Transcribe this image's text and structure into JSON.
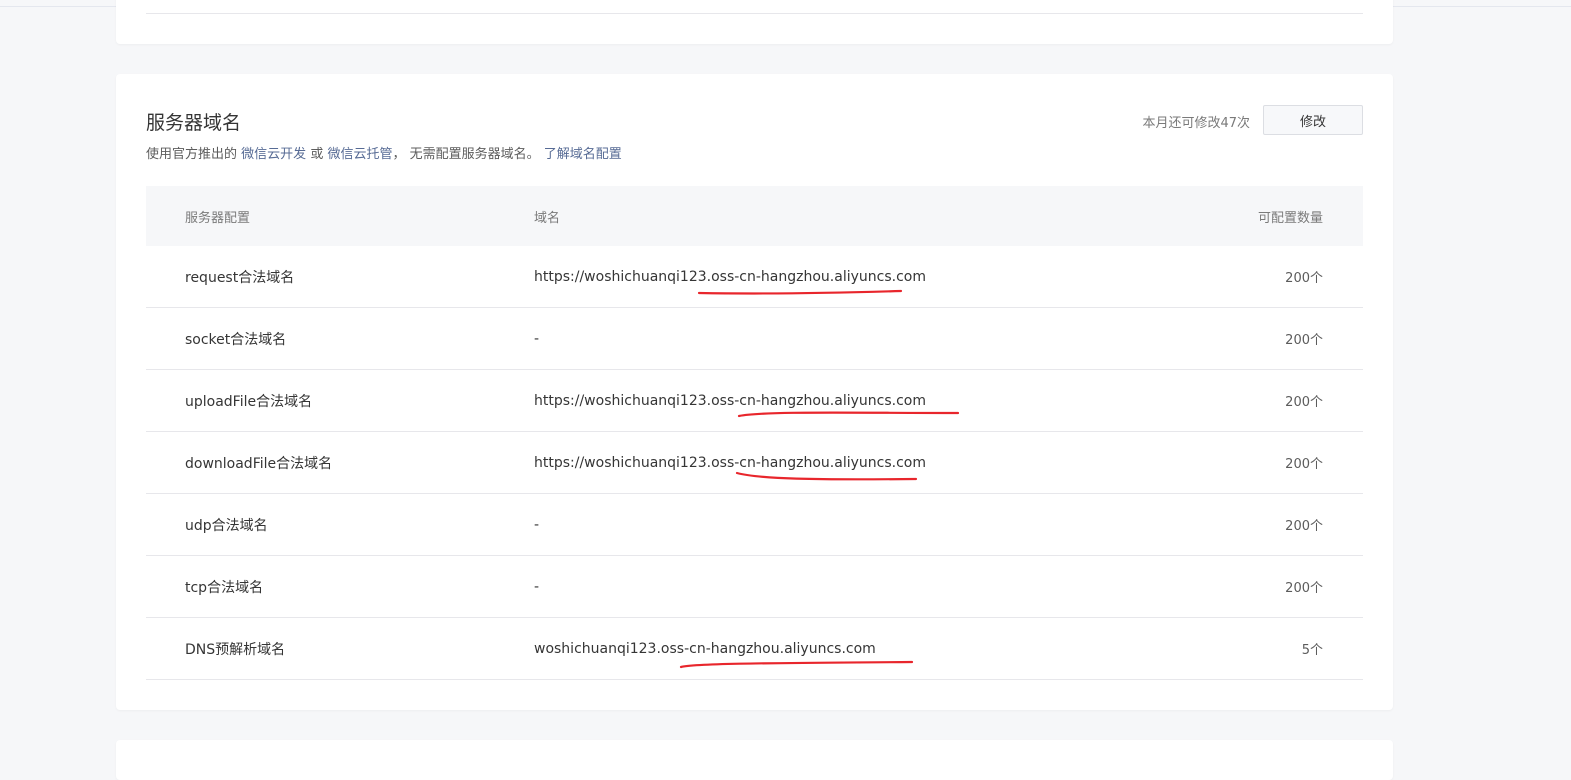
{
  "section": {
    "title": "服务器域名",
    "desc_prefix": "使用官方推出的",
    "link_cloud_dev": "微信云开发",
    "desc_or": "或",
    "link_cloud_hosting": "微信云托管",
    "desc_suffix": "，  无需配置服务器域名。",
    "link_learn": "了解域名配置"
  },
  "quota": {
    "text": "本月还可修改47次"
  },
  "toolbar": {
    "edit_label": "修改"
  },
  "table": {
    "headers": {
      "config": "服务器配置",
      "domain": "域名",
      "count": "可配置数量"
    },
    "rows": [
      {
        "config": "request合法域名",
        "domain": "https://woshichuanqi123.oss-cn-hangzhou.aliyuncs.com",
        "count": "200个"
      },
      {
        "config": "socket合法域名",
        "domain": "-",
        "count": "200个"
      },
      {
        "config": "uploadFile合法域名",
        "domain": "https://woshichuanqi123.oss-cn-hangzhou.aliyuncs.com",
        "count": "200个"
      },
      {
        "config": "downloadFile合法域名",
        "domain": "https://woshichuanqi123.oss-cn-hangzhou.aliyuncs.com",
        "count": "200个"
      },
      {
        "config": "udp合法域名",
        "domain": "-",
        "count": "200个"
      },
      {
        "config": "tcp合法域名",
        "domain": "-",
        "count": "200个"
      },
      {
        "config": "DNS预解析域名",
        "domain": "woshichuanqi123.oss-cn-hangzhou.aliyuncs.com",
        "count": "5个"
      }
    ]
  },
  "colors": {
    "link": "#576b95",
    "annotation": "#e8262c",
    "background": "#f6f7f9"
  }
}
